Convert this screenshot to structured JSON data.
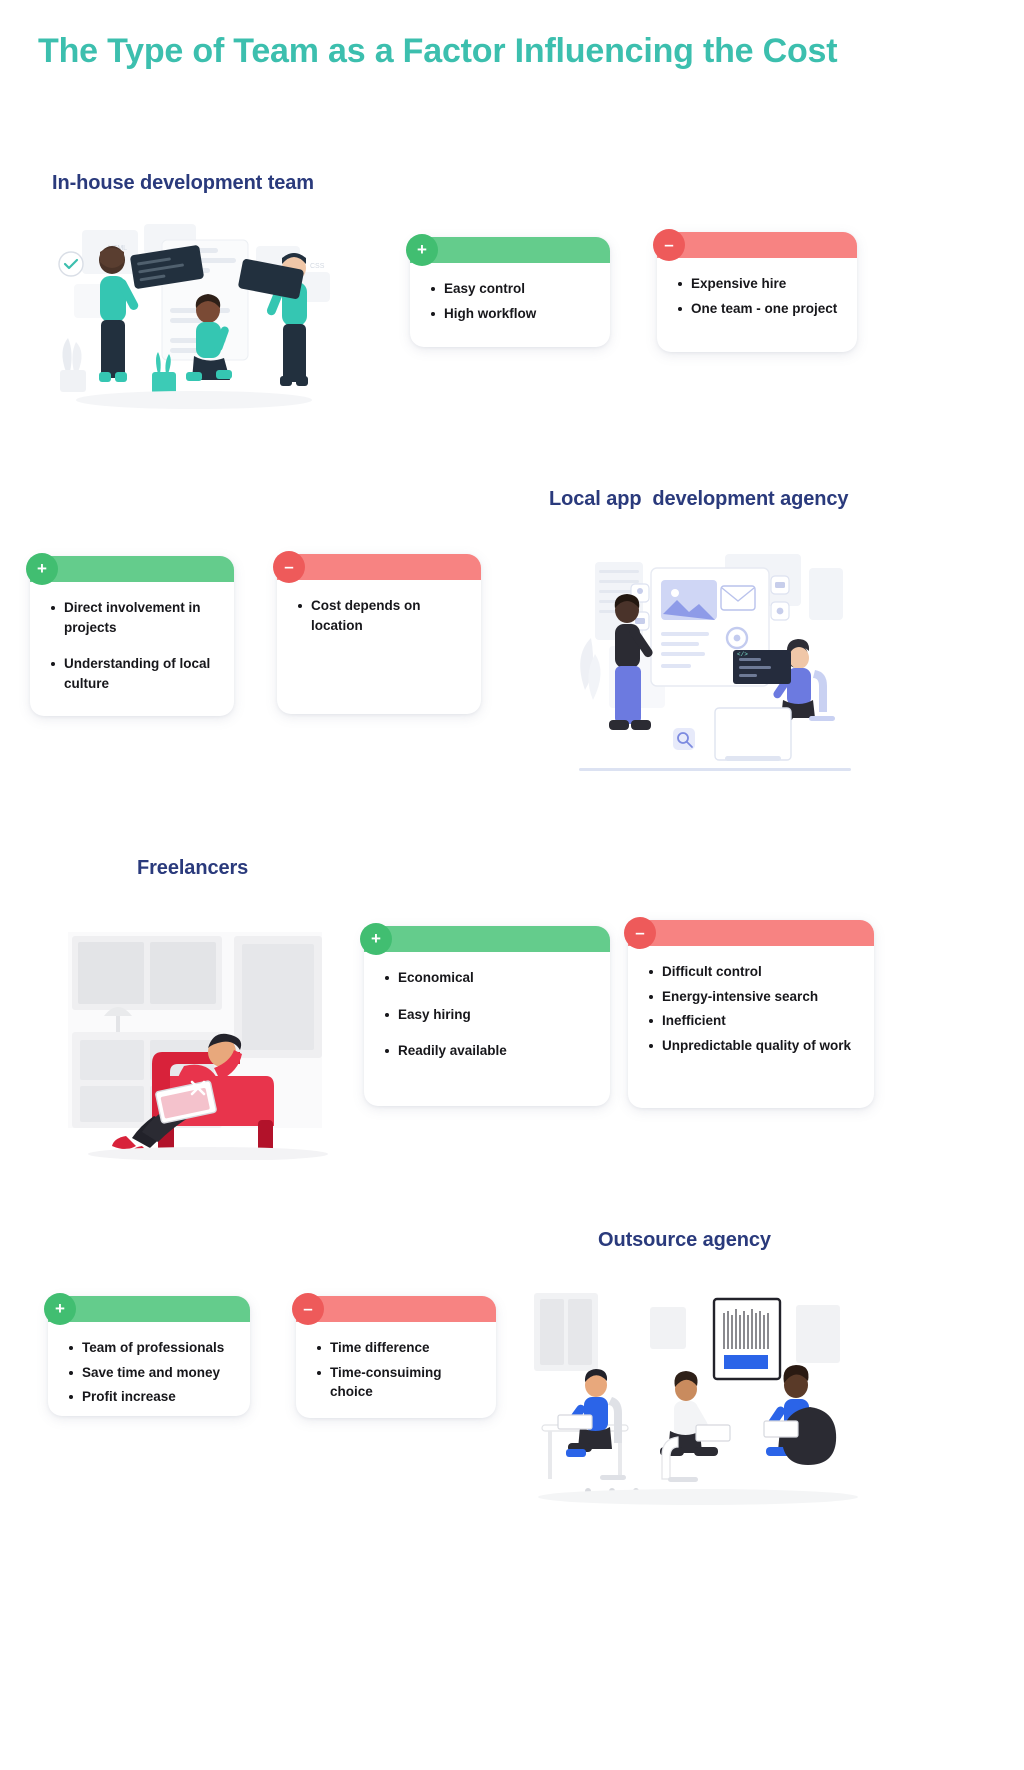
{
  "title": "The Type of Team as a Factor Influencing the Cost",
  "colors": {
    "title": "#3CBFAE",
    "heading": "#2A3A7C",
    "pro_bar": "#64CC8C",
    "pro_badge": "#41BE71",
    "con_bar": "#F78382",
    "con_badge": "#EE5A5A",
    "text": "#17171B"
  },
  "icons": {
    "plus": "+",
    "minus": "–"
  },
  "sections": [
    {
      "heading": "In-house development team",
      "pros": [
        "Easy control",
        "High workflow"
      ],
      "cons": [
        "Expensive hire",
        "One team - one project"
      ],
      "illustration": "in-house-team-illustration"
    },
    {
      "heading": "Local app  development agency",
      "pros": [
        "Direct involvement in projects",
        "Understanding of local culture"
      ],
      "cons": [
        "Cost depends on location"
      ],
      "illustration": "local-agency-illustration"
    },
    {
      "heading": "Freelancers",
      "pros": [
        "Economical",
        "Easy hiring",
        "Readily available"
      ],
      "cons": [
        "Difficult control",
        "Energy-intensive search",
        "Inefficient",
        "Unpredictable quality of work"
      ],
      "illustration": "freelancer-illustration"
    },
    {
      "heading": "Outsource agency",
      "pros": [
        "Team of professionals",
        "Save time and money",
        "Profit increase"
      ],
      "cons": [
        "Time difference",
        "Time-consuiming choice"
      ],
      "illustration": "outsource-agency-illustration"
    }
  ]
}
